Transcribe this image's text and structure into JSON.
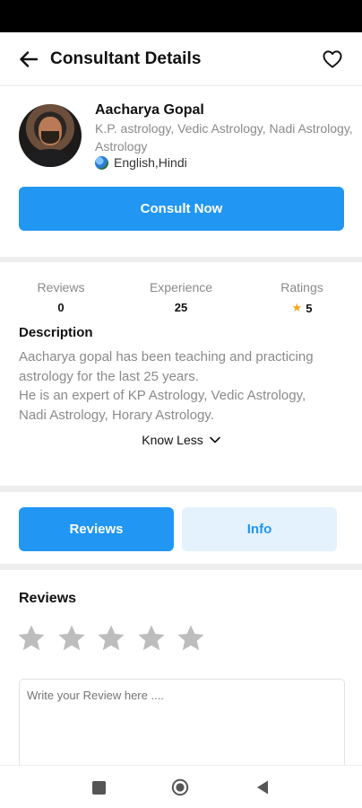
{
  "header": {
    "title": "Consultant Details"
  },
  "consultant": {
    "name": "Aacharya Gopal",
    "skills_line1": "K.P. astrology, Vedic Astrology, Nadi Astrology,",
    "skills_line2": "Astrology",
    "languages": "English,Hindi",
    "consult_label": "Consult Now"
  },
  "stats": {
    "reviews_label": "Reviews",
    "reviews_value": "0",
    "experience_label": "Experience",
    "experience_value": "25",
    "ratings_label": "Ratings",
    "ratings_value": "5"
  },
  "description": {
    "title": "Description",
    "line1": "Aacharya gopal has been teaching and practicing",
    "line2": "astrology for the last 25 years.",
    "line3": "He is an expert of KP Astrology, Vedic Astrology,",
    "line4": "Nadi Astrology, Horary Astrology.",
    "toggle_label": "Know Less"
  },
  "tabs": [
    {
      "label": "Reviews",
      "active": true
    },
    {
      "label": "Info",
      "active": false
    }
  ],
  "reviews": {
    "heading": "Reviews",
    "star_count": 5,
    "selected_stars": 0,
    "placeholder": "Write your Review here ...."
  },
  "colors": {
    "accent": "#2196f3",
    "accent_light": "#e3f2fd",
    "star_gold": "#f5a623",
    "star_empty": "#bdbdbd"
  },
  "icons": {
    "back": "arrow-left-icon",
    "favorite": "heart-outline-icon",
    "language": "globe-icon",
    "rating": "star-icon",
    "toggle": "chevron-down-icon",
    "nav_recent": "square-icon",
    "nav_home": "circle-icon",
    "nav_back": "triangle-left-icon"
  }
}
